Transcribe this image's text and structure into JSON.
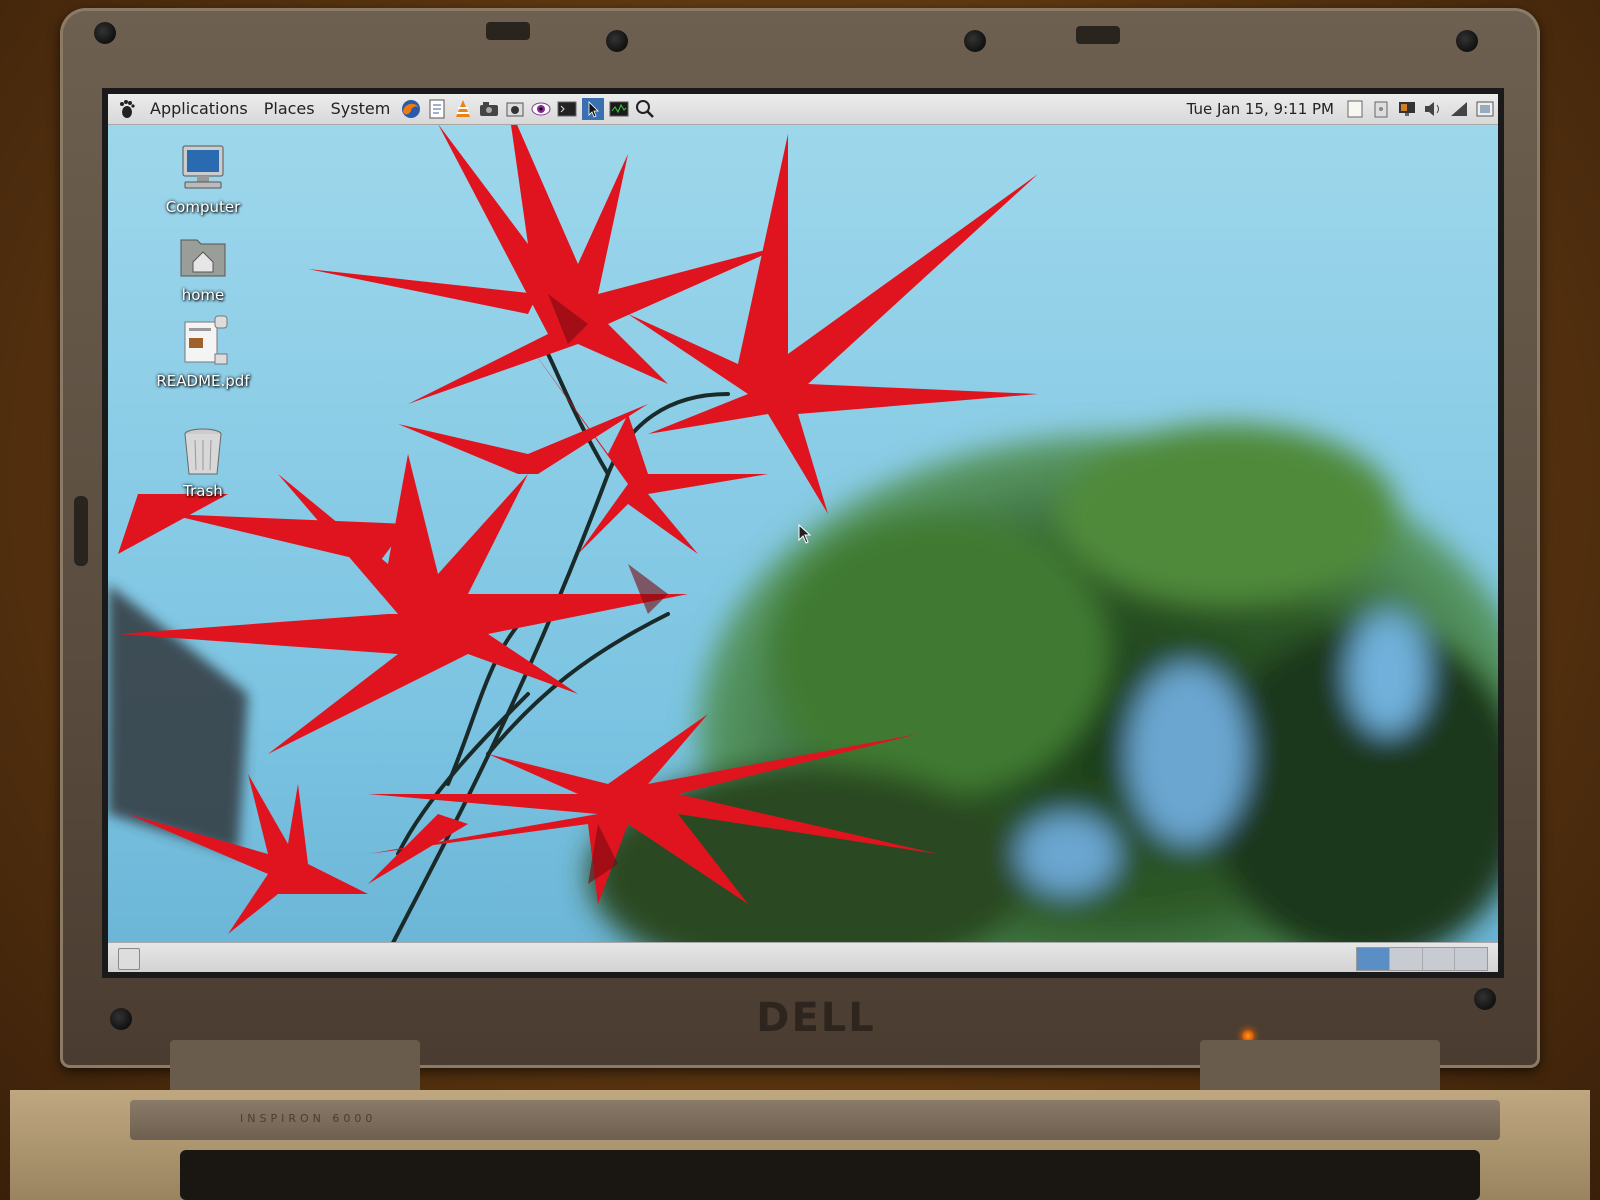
{
  "laptop": {
    "brand": "DELL",
    "model": "INSPIRON 6000"
  },
  "top_panel": {
    "menus": [
      {
        "label": "Applications",
        "icon": "gnome-foot-icon"
      },
      {
        "label": "Places"
      },
      {
        "label": "System"
      }
    ],
    "launchers": [
      "firefox-icon",
      "text-editor-icon",
      "vlc-icon",
      "screenshot-icon",
      "camera-icon",
      "eye-icon",
      "terminal-icon",
      "cursor-icon",
      "system-monitor-icon",
      "search-icon"
    ],
    "clock": "Tue Jan 15,  9:11 PM",
    "tray_icons": [
      "notes-icon",
      "clipboard-icon",
      "display-icon",
      "volume-icon",
      "network-icon",
      "window-list-icon"
    ]
  },
  "desktop_icons": [
    {
      "label": "Computer",
      "icon": "computer-icon"
    },
    {
      "label": "home",
      "icon": "home-folder-icon"
    },
    {
      "label": "README.pdf",
      "icon": "pdf-document-icon"
    },
    {
      "label": "Trash",
      "icon": "trash-icon"
    }
  ],
  "bottom_panel": {
    "workspaces": 4,
    "active_workspace": 1
  },
  "colors": {
    "sky": "#8fcfe6",
    "leaf_red": "#e0141e",
    "panel_gray": "#e0e0e0",
    "workspace_active": "#5a8ec4"
  }
}
